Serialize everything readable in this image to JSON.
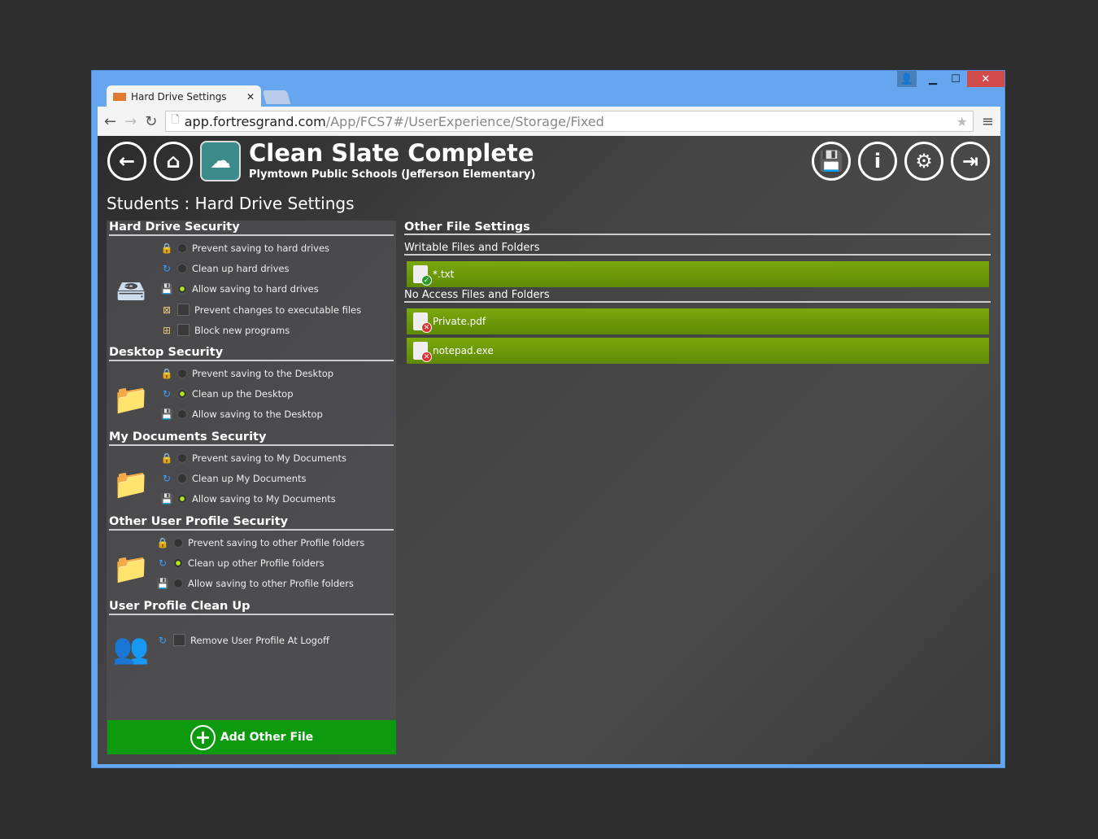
{
  "browser": {
    "tab_title": "Hard Drive Settings",
    "url_host": "app.fortresgrand.com",
    "url_path": "/App/FCS7#/UserExperience/Storage/Fixed"
  },
  "header": {
    "title": "Clean Slate Complete",
    "subtitle": "Plymtown Public Schools (Jefferson Elementary)"
  },
  "page_title": "Students : Hard Drive Settings",
  "sections": [
    {
      "title": "Hard Drive Security",
      "icon": "hard-drive-icon",
      "rows": [
        {
          "icon": "lock-icon",
          "type": "radio",
          "checked": false,
          "label": "Prevent saving to hard drives"
        },
        {
          "icon": "refresh-icon",
          "type": "radio",
          "checked": false,
          "label": "Clean up hard drives"
        },
        {
          "icon": "floppy-icon",
          "type": "radio",
          "checked": true,
          "label": "Allow saving to hard drives"
        },
        {
          "icon": "window-block-icon",
          "type": "checkbox",
          "checked": false,
          "label": "Prevent changes to executable files"
        },
        {
          "icon": "window-add-icon",
          "type": "checkbox",
          "checked": false,
          "label": "Block new programs"
        }
      ]
    },
    {
      "title": "Desktop Security",
      "icon": "desktop-folder-icon",
      "rows": [
        {
          "icon": "lock-icon",
          "type": "radio",
          "checked": false,
          "label": "Prevent saving to the Desktop"
        },
        {
          "icon": "refresh-icon",
          "type": "radio",
          "checked": true,
          "label": "Clean up the Desktop"
        },
        {
          "icon": "floppy-icon",
          "type": "radio",
          "checked": false,
          "label": "Allow saving to the Desktop"
        }
      ]
    },
    {
      "title": "My Documents Security",
      "icon": "documents-folder-icon",
      "rows": [
        {
          "icon": "lock-icon",
          "type": "radio",
          "checked": false,
          "label": "Prevent saving to My Documents"
        },
        {
          "icon": "refresh-icon",
          "type": "radio",
          "checked": false,
          "label": "Clean up My Documents"
        },
        {
          "icon": "floppy-icon",
          "type": "radio",
          "checked": true,
          "label": "Allow saving to My Documents"
        }
      ]
    },
    {
      "title": "Other User Profile Security",
      "icon": "profile-folder-icon",
      "rows": [
        {
          "icon": "lock-icon",
          "type": "radio",
          "checked": false,
          "label": "Prevent saving to other Profile folders"
        },
        {
          "icon": "refresh-icon",
          "type": "radio",
          "checked": true,
          "label": "Clean up other Profile folders"
        },
        {
          "icon": "floppy-icon",
          "type": "radio",
          "checked": false,
          "label": "Allow saving to other Profile folders"
        }
      ]
    },
    {
      "title": "User Profile Clean Up",
      "icon": "users-folder-icon",
      "rows": [
        {
          "icon": "refresh-icon",
          "type": "checkbox",
          "checked": false,
          "label": "Remove User Profile At Logoff"
        }
      ]
    }
  ],
  "add_button": "Add Other File",
  "other": {
    "title": "Other File Settings",
    "writable_title": "Writable Files and Folders",
    "writable": [
      "*.txt"
    ],
    "noaccess_title": "No Access Files and Folders",
    "noaccess": [
      "Private.pdf",
      "notepad.exe"
    ]
  }
}
